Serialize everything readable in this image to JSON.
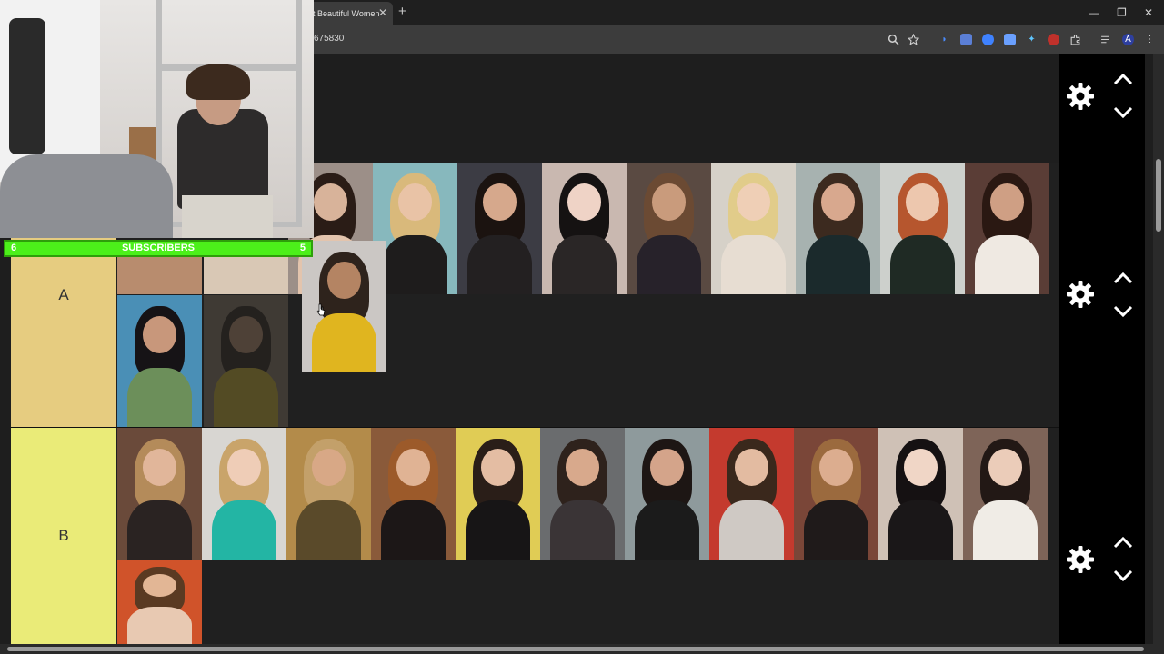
{
  "browser": {
    "tab_title": "t Beautiful Women",
    "tab_close": "✕",
    "new_tab": "+",
    "url": "675830",
    "window_minimize": "—",
    "window_restore": "❐",
    "window_close": "✕"
  },
  "overlay": {
    "subscriber_label": "SUBSCRIBERS",
    "count_left": "6",
    "count_right": "5"
  },
  "tiers": [
    {
      "label": "A",
      "color": "#e6cc80"
    },
    {
      "label": "B",
      "color": "#eaeb78"
    }
  ],
  "icons": {
    "gear": "gear-icon",
    "up": "chevron-up-icon",
    "down": "chevron-down-icon"
  }
}
